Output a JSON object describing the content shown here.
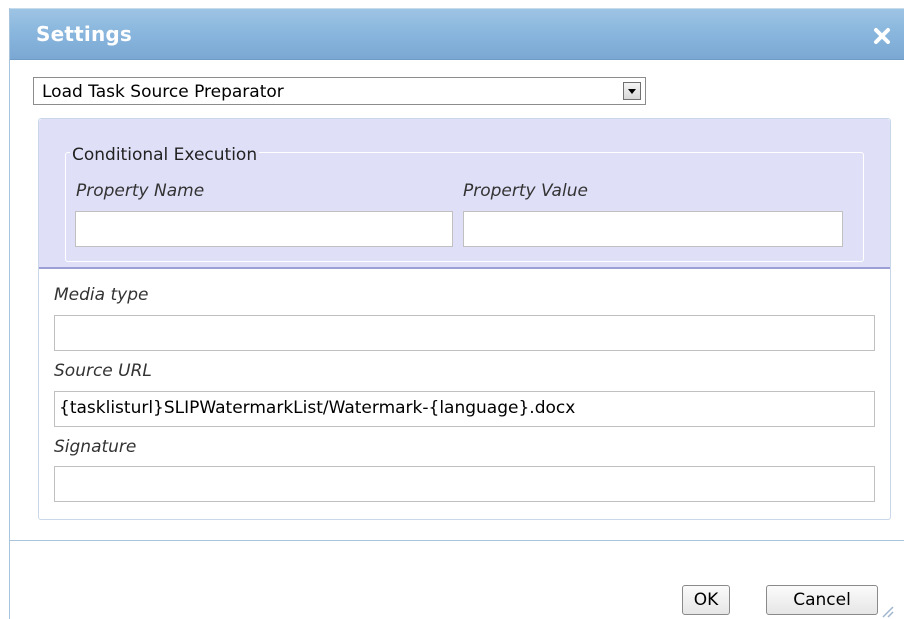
{
  "dialog": {
    "title": "Settings",
    "close_icon": "close-icon"
  },
  "task_select": {
    "selected": "Load Task Source Preparator"
  },
  "conditional_execution": {
    "legend": "Conditional Execution",
    "property_name_label": "Property Name",
    "property_name_value": "",
    "property_value_label": "Property Value",
    "property_value_value": ""
  },
  "fields": {
    "media_type_label": "Media type",
    "media_type_value": "",
    "source_url_label": "Source URL",
    "source_url_value": "{tasklisturl}SLIPWatermarkList/Watermark-{language}.docx",
    "signature_label": "Signature",
    "signature_value": ""
  },
  "buttons": {
    "ok_label": "OK",
    "cancel_label": "Cancel"
  },
  "colors": {
    "titlebar": "#8ab7de",
    "conditional_bg": "#dfe0f8"
  }
}
